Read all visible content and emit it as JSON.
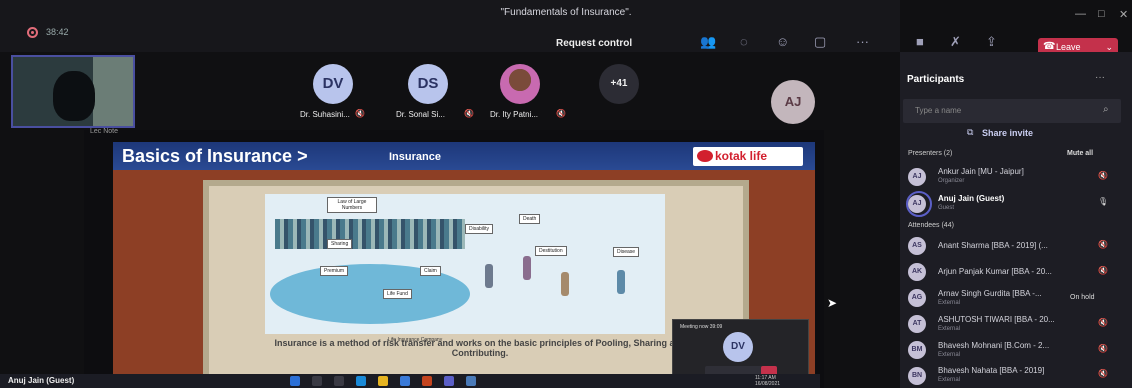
{
  "window": {
    "title": "\"Fundamentals of Insurance\".",
    "timer": "38:42"
  },
  "toolbar": {
    "request_control": "Request control",
    "leave": "Leave"
  },
  "participants_strip": [
    {
      "initials": "DV",
      "name": "Dr. Suhasini..."
    },
    {
      "initials": "DS",
      "name": "Dr. Sonal Si..."
    },
    {
      "initials": "",
      "name": "Dr. Ity Patni..."
    },
    {
      "initials": "+41",
      "name": ""
    }
  ],
  "active_speaker": {
    "initials": "AJ"
  },
  "stage": {
    "header": "Lec Note"
  },
  "slide": {
    "title": "Basics of Insurance >",
    "subtitle": "Insurance",
    "logo": "kotak life",
    "labels": {
      "law": "Law of Large Numbers",
      "sharing": "Sharing",
      "premium": "Premium",
      "claim": "Claim",
      "life_fund": "Life Fund",
      "disability": "Disability",
      "death": "Death",
      "destitution": "Destitution",
      "disease": "Disease",
      "company": "Life Insurance Company"
    },
    "caption": "Insurance is a method of risk transfer and works on the basic principles of Pooling, Sharing and Contributing."
  },
  "mini_meeting": {
    "title": "Meeting now",
    "time": "39:09",
    "initials": "DV"
  },
  "taskbar": {
    "user": "Anuj Jain (Guest)",
    "time": "11:17 AM",
    "date": "16/08/2021"
  },
  "panel": {
    "title": "Participants",
    "search_placeholder": "Type a name",
    "share_invite": "Share invite",
    "presenters_label": "Presenters (2)",
    "mute_all": "Mute all",
    "attendees_label": "Attendees (44)",
    "on_hold": "On hold",
    "presenters": [
      {
        "initials": "AJ",
        "name": "Ankur Jain [MU - Jaipur]",
        "role": "Organizer"
      },
      {
        "initials": "AJ",
        "name": "Anuj Jain (Guest)",
        "role": "Guest"
      }
    ],
    "attendees": [
      {
        "initials": "AS",
        "name": "Anant Sharma [BBA - 2019] (...",
        "role": ""
      },
      {
        "initials": "AK",
        "name": "Arjun Panjak Kumar [BBA - 20...",
        "role": ""
      },
      {
        "initials": "AG",
        "name": "Arnav Singh Gurdita [BBA -...",
        "role": "External"
      },
      {
        "initials": "AT",
        "name": "ASHUTOSH TIWARI [BBA - 20...",
        "role": "External"
      },
      {
        "initials": "BM",
        "name": "Bhavesh Mohnani [B.Com - 2...",
        "role": "External"
      },
      {
        "initials": "BN",
        "name": "Bhavesh Nahata [BBA - 2019]",
        "role": "External"
      }
    ]
  },
  "colors": {
    "accent": "#5b5fc7",
    "leave": "#c4314b",
    "slide_header": "#1d3779",
    "kotak_red": "#d21f2e"
  }
}
